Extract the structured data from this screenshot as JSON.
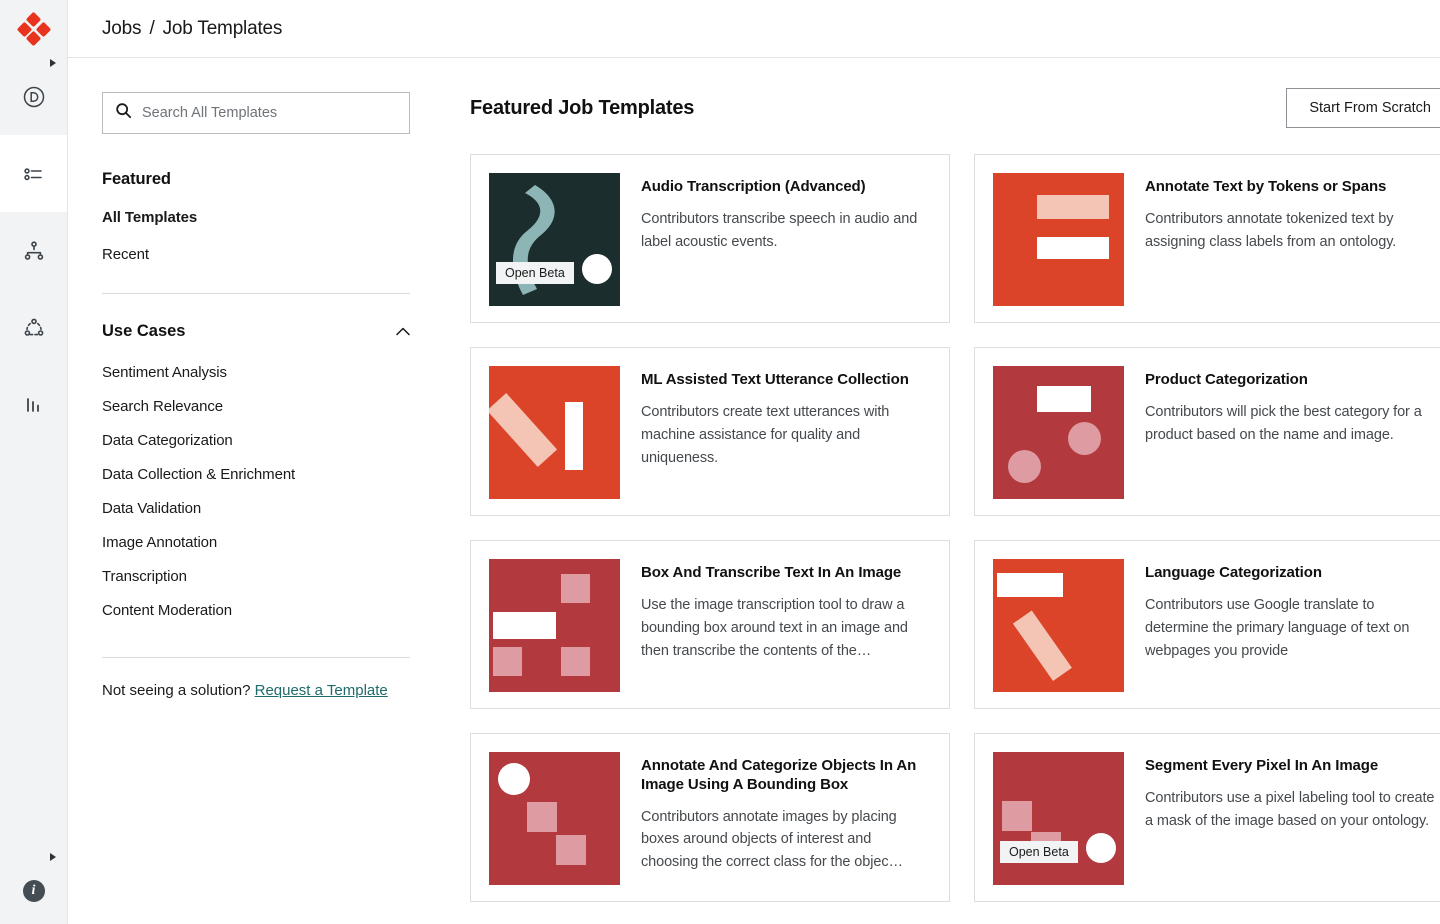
{
  "brand": {
    "logo": "appen-diamond-logo",
    "accent": "#e8331f"
  },
  "rail": {
    "caret_top": "expand-caret-icon",
    "caret_bottom": "expand-caret-icon",
    "items": [
      {
        "name": "sidebar-item-data",
        "icon": "circle-d-icon",
        "active": false
      },
      {
        "name": "sidebar-item-jobs",
        "icon": "list-icon",
        "active": true
      },
      {
        "name": "sidebar-item-workflows",
        "icon": "hierarchy-icon",
        "active": false
      },
      {
        "name": "sidebar-item-contributors",
        "icon": "network-nodes-icon",
        "active": false
      },
      {
        "name": "sidebar-item-analytics",
        "icon": "bar-chart-icon",
        "active": false
      }
    ],
    "info": "info-icon"
  },
  "breadcrumb": {
    "parent": "Jobs",
    "separator": "/",
    "current": "Job Templates"
  },
  "search": {
    "placeholder": "Search All Templates",
    "value": "",
    "icon": "search-icon"
  },
  "filters": {
    "featured_heading": "Featured",
    "links": [
      {
        "label": "All Templates",
        "strong": true
      },
      {
        "label": "Recent",
        "strong": false
      }
    ],
    "use_cases_heading": "Use Cases",
    "collapse_icon": "chevron-up-icon",
    "use_cases": [
      "Sentiment Analysis",
      "Search Relevance",
      "Data Categorization",
      "Data Collection & Enrichment",
      "Data Validation",
      "Image Annotation",
      "Transcription",
      "Content Moderation"
    ],
    "ask_text": "Not seeing a solution?",
    "ask_link": "Request a Template",
    "ask_link_color": "#1f6a6a"
  },
  "main": {
    "title": "Featured Job Templates",
    "start_from_scratch": "Start From Scratch",
    "cards": [
      {
        "title": "Audio Transcription (Advanced)",
        "desc": "Contributors transcribe speech in audio and label acoustic events.",
        "badge": "Open Beta",
        "thumb": "audio-wave-thumbnail",
        "bg": "#1b2d2d"
      },
      {
        "title": "Annotate Text by Tokens or Spans",
        "desc": "Contributors annotate tokenized text by assigning class labels from an ontology.",
        "badge": null,
        "thumb": "text-bars-thumbnail",
        "bg": "#db4428"
      },
      {
        "title": "ML Assisted Text Utterance Collection",
        "desc": "Contributors create text utterances with machine assistance for quality and uniqueness.",
        "badge": null,
        "thumb": "diagonal-bar-thumbnail",
        "bg": "#db4428"
      },
      {
        "title": "Product Categorization",
        "desc": "Contributors will pick the best category for a product based on the name and image.",
        "badge": null,
        "thumb": "box-and-circles-thumbnail",
        "bg": "#b23a3f"
      },
      {
        "title": "Box And Transcribe Text In An Image",
        "desc": "Use the image transcription tool to draw a bounding box around text in an image and then transcribe the contents of the…",
        "badge": null,
        "thumb": "boxes-grid-thumbnail",
        "bg": "#b23a3f"
      },
      {
        "title": "Language Categorization",
        "desc": "Contributors use Google translate to determine the primary language of text on webpages you provide",
        "badge": null,
        "thumb": "bar-and-diagonal-thumbnail",
        "bg": "#db4428"
      },
      {
        "title": "Annotate And Categorize Objects In An Image Using A Bounding Box",
        "desc": "Contributors annotate images by placing boxes around objects of interest and choosing the correct class for the objec…",
        "badge": null,
        "thumb": "circle-and-squares-thumbnail",
        "bg": "#b23a3f"
      },
      {
        "title": "Segment Every Pixel In An Image",
        "desc": "Contributors use a pixel labeling tool to create a mask of the image based on your ontology.",
        "badge": "Open Beta",
        "thumb": "segment-squares-thumbnail",
        "bg": "#b23a3f"
      }
    ]
  }
}
